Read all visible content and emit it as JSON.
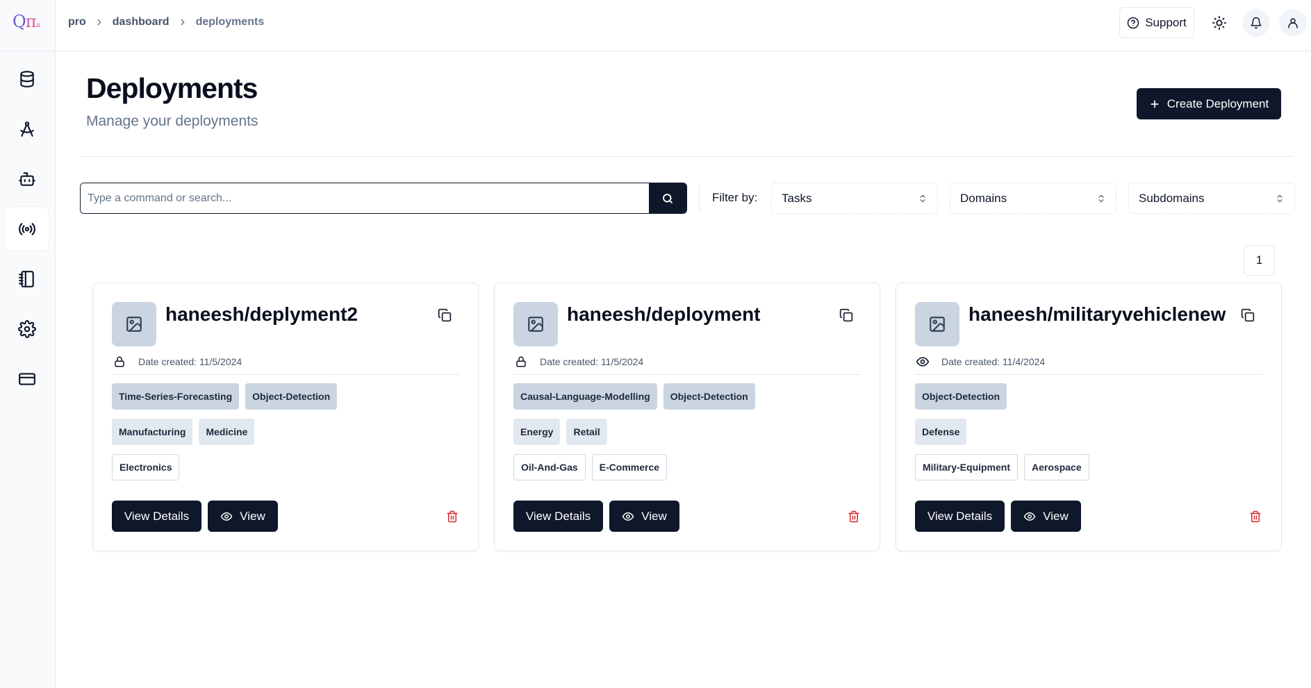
{
  "app": {
    "logo_q": "Q",
    "logo_pi": "π",
    "logo_sub": "AI"
  },
  "breadcrumb": [
    "pro",
    "dashboard",
    "deployments"
  ],
  "topbar": {
    "support_label": "Support",
    "icons": [
      "help-circle-icon",
      "sun-icon",
      "bell-icon",
      "user-icon"
    ]
  },
  "sidebar": {
    "items": [
      {
        "icon": "database-icon",
        "active": false
      },
      {
        "icon": "compass-icon",
        "active": false
      },
      {
        "icon": "bot-icon",
        "active": false
      },
      {
        "icon": "radio-broadcast-icon",
        "active": true
      },
      {
        "icon": "notebook-icon",
        "active": false
      },
      {
        "icon": "settings-icon",
        "active": false
      },
      {
        "icon": "credit-card-icon",
        "active": false
      }
    ]
  },
  "header": {
    "title": "Deployments",
    "subtitle": "Manage your deployments",
    "create_label": "Create Deployment"
  },
  "search": {
    "placeholder": "Type a command or search...",
    "value": ""
  },
  "filters": {
    "label": "Filter by:",
    "tasks": "Tasks",
    "domains": "Domains",
    "subdomains": "Subdomains"
  },
  "pagination": {
    "current": "1"
  },
  "cards": [
    {
      "title": "haneesh/deplyment2",
      "visibility": "lock-icon",
      "date": "Date created: 11/5/2024",
      "tasks": [
        "Time-Series-Forecasting",
        "Object-Detection"
      ],
      "domains": [
        "Manufacturing",
        "Medicine"
      ],
      "subdomains": [
        "Electronics"
      ],
      "details_label": "View Details",
      "view_label": "View"
    },
    {
      "title": "haneesh/deployment",
      "visibility": "lock-icon",
      "date": "Date created: 11/5/2024",
      "tasks": [
        "Causal-Language-Modelling",
        "Object-Detection"
      ],
      "domains": [
        "Energy",
        "Retail"
      ],
      "subdomains": [
        "Oil-And-Gas",
        "E-Commerce"
      ],
      "details_label": "View Details",
      "view_label": "View"
    },
    {
      "title": "haneesh/militaryvehiclenew",
      "visibility": "eye-icon",
      "date": "Date created: 11/4/2024",
      "tasks": [
        "Object-Detection"
      ],
      "domains": [
        "Defense"
      ],
      "subdomains": [
        "Military-Equipment",
        "Aerospace"
      ],
      "details_label": "View Details",
      "view_label": "View"
    }
  ],
  "colors": {
    "primary": "#0f172a",
    "danger": "#dc2626",
    "muted": "#64748b",
    "task_tag": "#cbd5e1",
    "domain_tag": "#e2e8f0"
  }
}
